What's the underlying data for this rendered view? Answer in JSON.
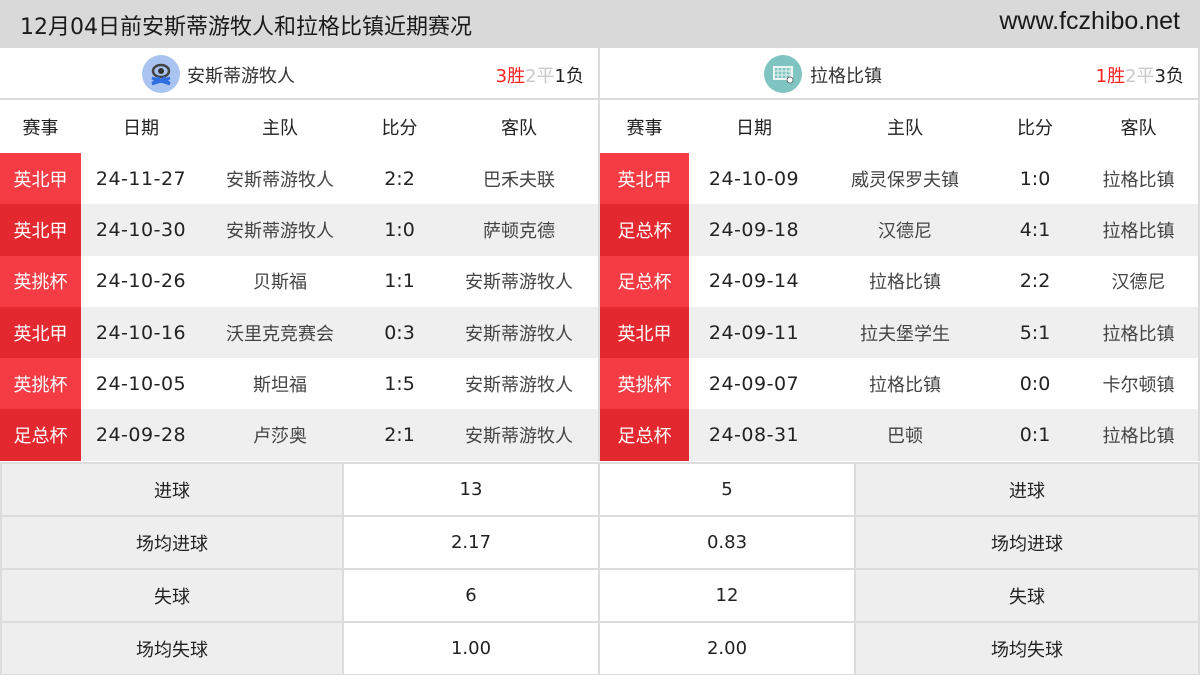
{
  "header": {
    "title": "12月04日前安斯蒂游牧人和拉格比镇近期赛况",
    "site": "www.fczhibo.net"
  },
  "colors": {
    "win": "#ff2020",
    "draw": "#c8c8c8",
    "competition_badge": "#f53c44",
    "left_logo_bg": "#a9c4f0",
    "right_logo_bg": "#7fc4c0"
  },
  "columns": [
    "赛事",
    "日期",
    "主队",
    "比分",
    "客队"
  ],
  "left": {
    "team": "安斯蒂游牧人",
    "logo_icon": "team-crest-icon",
    "record": {
      "win": "3胜",
      "draw": "2平",
      "loss": "1负"
    },
    "matches": [
      {
        "competition": "英北甲",
        "date": "24-11-27",
        "home": "安斯蒂游牧人",
        "score": "2:2",
        "away": "巴禾夫联"
      },
      {
        "competition": "英北甲",
        "date": "24-10-30",
        "home": "安斯蒂游牧人",
        "score": "1:0",
        "away": "萨顿克德"
      },
      {
        "competition": "英挑杯",
        "date": "24-10-26",
        "home": "贝斯福",
        "score": "1:1",
        "away": "安斯蒂游牧人"
      },
      {
        "competition": "英北甲",
        "date": "24-10-16",
        "home": "沃里克竞赛会",
        "score": "0:3",
        "away": "安斯蒂游牧人"
      },
      {
        "competition": "英挑杯",
        "date": "24-10-05",
        "home": "斯坦福",
        "score": "1:5",
        "away": "安斯蒂游牧人"
      },
      {
        "competition": "足总杯",
        "date": "24-09-28",
        "home": "卢莎奥",
        "score": "2:1",
        "away": "安斯蒂游牧人"
      }
    ]
  },
  "right": {
    "team": "拉格比镇",
    "logo_icon": "goal-net-icon",
    "record": {
      "win": "1胜",
      "draw": "2平",
      "loss": "3负"
    },
    "matches": [
      {
        "competition": "英北甲",
        "date": "24-10-09",
        "home": "威灵保罗夫镇",
        "score": "1:0",
        "away": "拉格比镇"
      },
      {
        "competition": "足总杯",
        "date": "24-09-18",
        "home": "汉德尼",
        "score": "4:1",
        "away": "拉格比镇"
      },
      {
        "competition": "足总杯",
        "date": "24-09-14",
        "home": "拉格比镇",
        "score": "2:2",
        "away": "汉德尼"
      },
      {
        "competition": "英北甲",
        "date": "24-09-11",
        "home": "拉夫堡学生",
        "score": "5:1",
        "away": "拉格比镇"
      },
      {
        "competition": "英挑杯",
        "date": "24-09-07",
        "home": "拉格比镇",
        "score": "0:0",
        "away": "卡尔顿镇"
      },
      {
        "competition": "足总杯",
        "date": "24-08-31",
        "home": "巴顿",
        "score": "0:1",
        "away": "拉格比镇"
      }
    ]
  },
  "stats": [
    {
      "label": "进球",
      "left": "13",
      "right": "5"
    },
    {
      "label": "场均进球",
      "left": "2.17",
      "right": "0.83"
    },
    {
      "label": "失球",
      "left": "6",
      "right": "12"
    },
    {
      "label": "场均失球",
      "left": "1.00",
      "right": "2.00"
    }
  ]
}
